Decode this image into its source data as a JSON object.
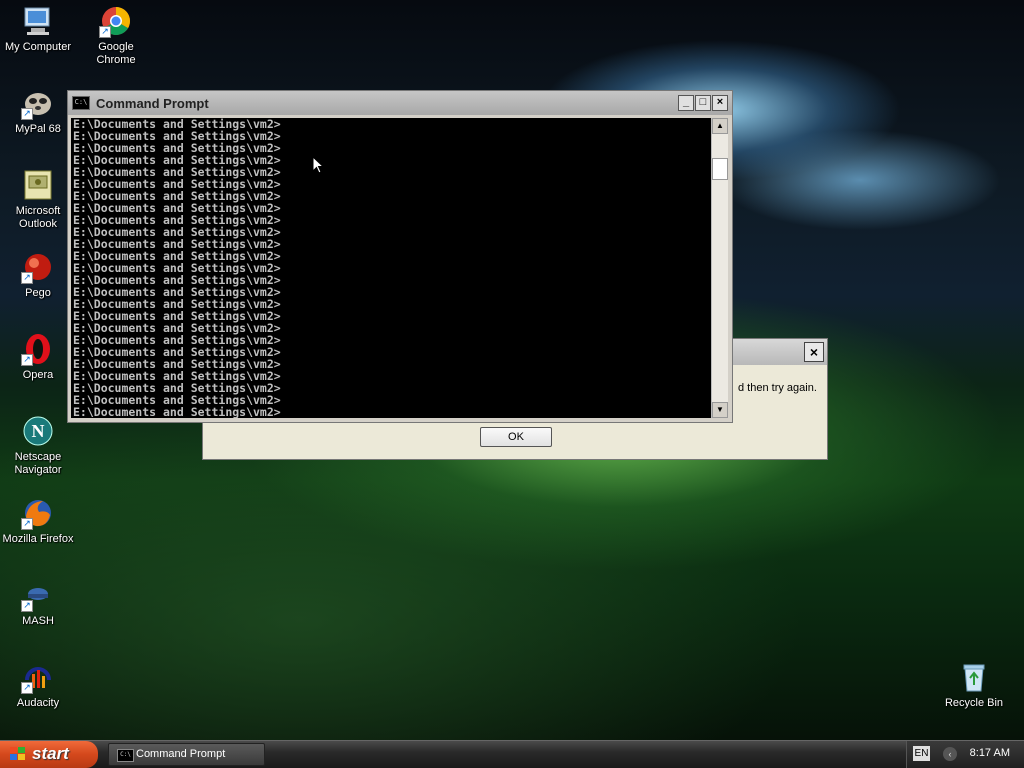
{
  "desktop": {
    "icons": [
      {
        "label": "My Computer",
        "glyph": "computer-icon"
      },
      {
        "label": "Google Chrome",
        "glyph": "chrome-icon"
      },
      {
        "label": "MyPal 68",
        "glyph": "mypal-icon"
      },
      {
        "label": "Microsoft Outlook",
        "glyph": "outlook-icon"
      },
      {
        "label": "Pego",
        "glyph": "pego-icon"
      },
      {
        "label": "Opera",
        "glyph": "opera-icon"
      },
      {
        "label": "Netscape Navigator",
        "glyph": "netscape-icon"
      },
      {
        "label": "Mozilla Firefox",
        "glyph": "firefox-icon"
      },
      {
        "label": "MASH",
        "glyph": "mash-icon"
      },
      {
        "label": "Audacity",
        "glyph": "audacity-icon"
      },
      {
        "label": "Recycle Bin",
        "glyph": "recycle-bin-icon"
      }
    ]
  },
  "cmd": {
    "title": "Command Prompt",
    "icon_text": "C:\\",
    "minimize": "_",
    "maximize": "□",
    "close": "×",
    "lines": [
      "E:\\Documents and Settings\\vm2>",
      "E:\\Documents and Settings\\vm2>",
      "E:\\Documents and Settings\\vm2>",
      "E:\\Documents and Settings\\vm2>",
      "E:\\Documents and Settings\\vm2>",
      "E:\\Documents and Settings\\vm2>",
      "E:\\Documents and Settings\\vm2>",
      "E:\\Documents and Settings\\vm2>",
      "E:\\Documents and Settings\\vm2>",
      "E:\\Documents and Settings\\vm2>",
      "E:\\Documents and Settings\\vm2>",
      "E:\\Documents and Settings\\vm2>",
      "E:\\Documents and Settings\\vm2>",
      "E:\\Documents and Settings\\vm2>",
      "E:\\Documents and Settings\\vm2>",
      "E:\\Documents and Settings\\vm2>",
      "E:\\Documents and Settings\\vm2>",
      "E:\\Documents and Settings\\vm2>",
      "E:\\Documents and Settings\\vm2>",
      "E:\\Documents and Settings\\vm2>",
      "E:\\Documents and Settings\\vm2>",
      "E:\\Documents and Settings\\vm2>",
      "E:\\Documents and Settings\\vm2>",
      "E:\\Documents and Settings\\vm2>",
      "E:\\Documents and Settings\\vm2>"
    ],
    "scroll_up": "▲",
    "scroll_down": "▼"
  },
  "dialog": {
    "close": "×",
    "message_fragment": "d then try again.",
    "ok_label": "OK"
  },
  "taskbar": {
    "start_label": "start",
    "task_label": "Command Prompt",
    "task_icon_text": "C:\\",
    "language": "EN",
    "tray_arrow": "‹",
    "clock": "8:17 AM"
  },
  "colors": {
    "start": "#d4481c",
    "console_bg": "#000000",
    "console_fg": "#c0c0c0"
  }
}
